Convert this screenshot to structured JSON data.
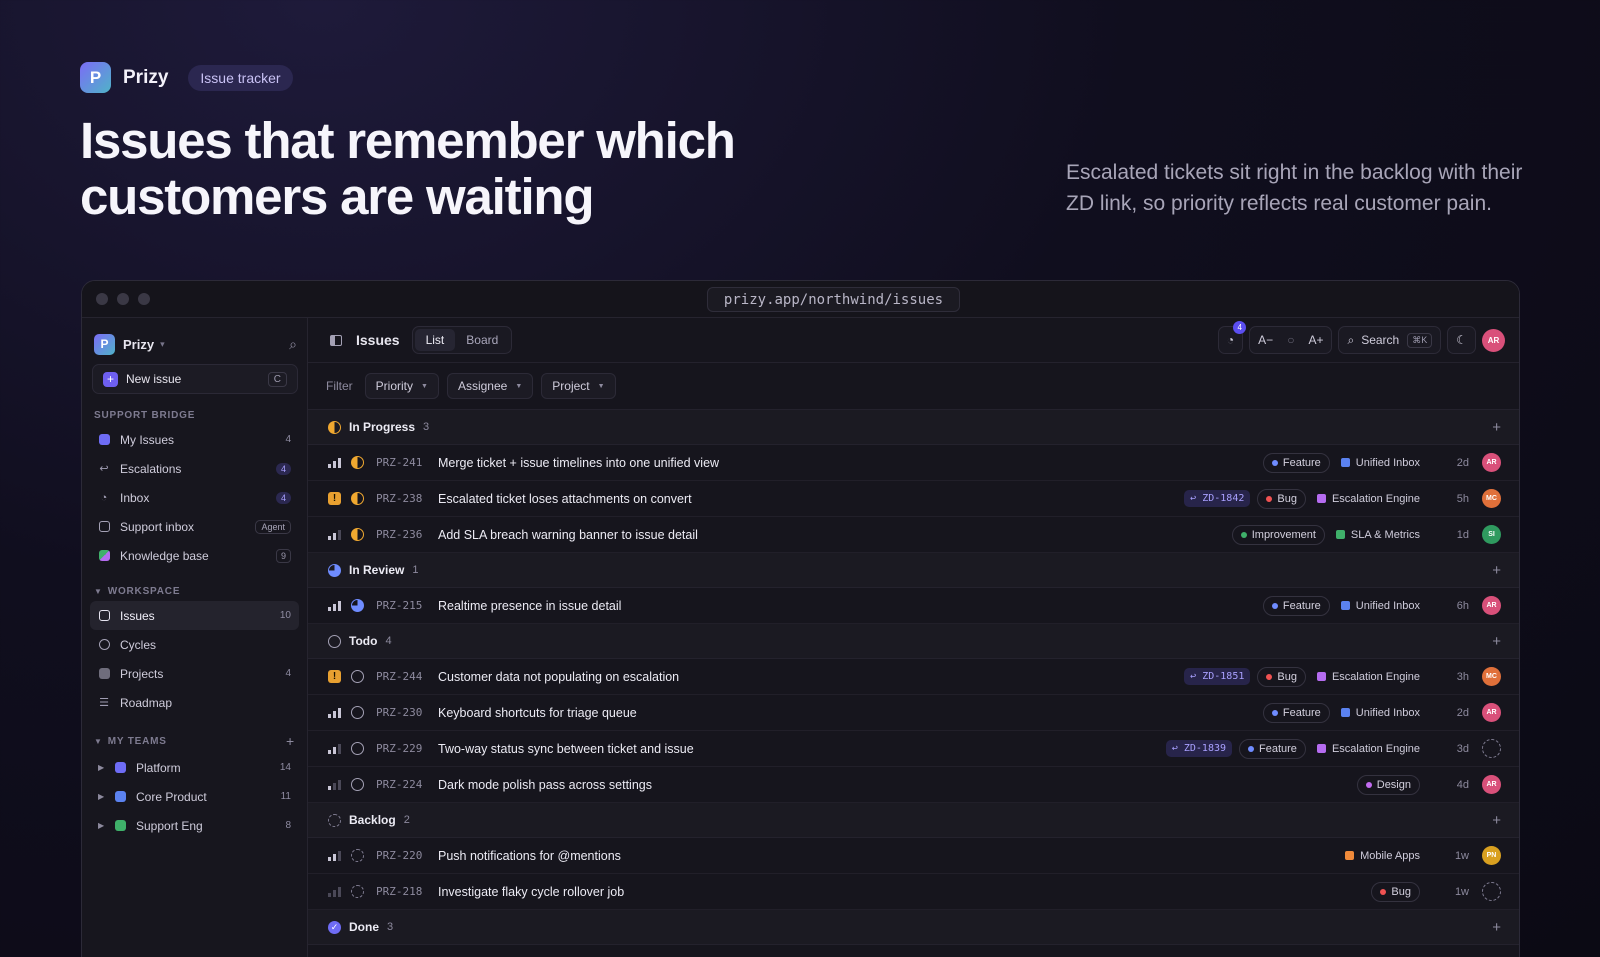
{
  "brand": {
    "name": "Prizy",
    "tag": "Issue tracker",
    "logo_letter": "P"
  },
  "hero": {
    "title": "Issues that remember which customers are waiting",
    "subtitle": "Escalated tickets sit right in the backlog with their ZD link, so priority reflects real customer pain."
  },
  "browser": {
    "url": "prizy.app/northwind/issues"
  },
  "sidebar": {
    "workspace_name": "Prizy",
    "new_issue": {
      "label": "New issue",
      "shortcut": "C"
    },
    "support_section": "SUPPORT BRIDGE",
    "support_items": [
      {
        "label": "My Issues",
        "count": "4"
      },
      {
        "label": "Escalations",
        "count": "4"
      },
      {
        "label": "Inbox",
        "count": "4"
      },
      {
        "label": "Support inbox",
        "badge": "Agent"
      },
      {
        "label": "Knowledge base",
        "count": "9"
      }
    ],
    "workspace_section": "WORKSPACE",
    "workspace_items": [
      {
        "label": "Issues",
        "count": "10"
      },
      {
        "label": "Cycles",
        "count": ""
      },
      {
        "label": "Projects",
        "count": "4"
      },
      {
        "label": "Roadmap",
        "count": ""
      }
    ],
    "teams_section": "MY TEAMS",
    "teams": [
      {
        "label": "Platform",
        "count": "14",
        "color": "#6e6cf5"
      },
      {
        "label": "Core Product",
        "count": "11",
        "color": "#5b82f0"
      },
      {
        "label": "Support Eng",
        "count": "8",
        "color": "#3fb06a"
      }
    ]
  },
  "topbar": {
    "title": "Issues",
    "views": [
      "List",
      "Board"
    ],
    "notif_count": "4",
    "zoom_out": "A−",
    "zoom_in": "A+",
    "search_label": "Search",
    "search_kbd": "⌘K",
    "user_initials": "AR"
  },
  "filters": {
    "label": "Filter",
    "items": [
      "Priority",
      "Assignee",
      "Project"
    ]
  },
  "groups": [
    {
      "label": "In Progress",
      "count": "3",
      "status": "progress",
      "rows": [
        {
          "id": "PRZ-241",
          "title": "Merge ticket + issue timelines into one unified view",
          "priority": 3,
          "zd": "",
          "tags": [
            {
              "label": "Feature",
              "color": "#6f8cff"
            }
          ],
          "project": {
            "label": "Unified Inbox",
            "color": "#5b82f0"
          },
          "age": "2d",
          "assignee": "AR",
          "assignee_color": "#d9507a"
        },
        {
          "id": "PRZ-238",
          "title": "Escalated ticket loses attachments on convert",
          "priority": "urgent",
          "zd": "↩ ZD-1842",
          "tags": [
            {
              "label": "Bug",
              "color": "#f05252"
            }
          ],
          "project": {
            "label": "Escalation Engine",
            "color": "#b56cf0"
          },
          "age": "5h",
          "assignee": "MC",
          "assignee_color": "#e0703a"
        },
        {
          "id": "PRZ-236",
          "title": "Add SLA breach warning banner to issue detail",
          "priority": 2,
          "zd": "",
          "tags": [
            {
              "label": "Improvement",
              "color": "#3fb06a"
            }
          ],
          "project": {
            "label": "SLA & Metrics",
            "color": "#3fb06a"
          },
          "age": "1d",
          "assignee": "SI",
          "assignee_color": "#2f9a5f"
        }
      ]
    },
    {
      "label": "In Review",
      "count": "1",
      "status": "review",
      "rows": [
        {
          "id": "PRZ-215",
          "title": "Realtime presence in issue detail",
          "priority": 3,
          "zd": "",
          "tags": [
            {
              "label": "Feature",
              "color": "#6f8cff"
            }
          ],
          "project": {
            "label": "Unified Inbox",
            "color": "#5b82f0"
          },
          "age": "6h",
          "assignee": "AR",
          "assignee_color": "#d9507a"
        }
      ]
    },
    {
      "label": "Todo",
      "count": "4",
      "status": "todo",
      "rows": [
        {
          "id": "PRZ-244",
          "title": "Customer data not populating on escalation",
          "priority": "urgent",
          "zd": "↩ ZD-1851",
          "tags": [
            {
              "label": "Bug",
              "color": "#f05252"
            }
          ],
          "project": {
            "label": "Escalation Engine",
            "color": "#b56cf0"
          },
          "age": "3h",
          "assignee": "MC",
          "assignee_color": "#e0703a"
        },
        {
          "id": "PRZ-230",
          "title": "Keyboard shortcuts for triage queue",
          "priority": 3,
          "zd": "",
          "tags": [
            {
              "label": "Feature",
              "color": "#6f8cff"
            }
          ],
          "project": {
            "label": "Unified Inbox",
            "color": "#5b82f0"
          },
          "age": "2d",
          "assignee": "AR",
          "assignee_color": "#d9507a"
        },
        {
          "id": "PRZ-229",
          "title": "Two-way status sync between ticket and issue",
          "priority": 2,
          "zd": "↩ ZD-1839",
          "tags": [
            {
              "label": "Feature",
              "color": "#6f8cff"
            }
          ],
          "project": {
            "label": "Escalation Engine",
            "color": "#b56cf0"
          },
          "age": "3d",
          "assignee": "",
          "assignee_color": ""
        },
        {
          "id": "PRZ-224",
          "title": "Dark mode polish pass across settings",
          "priority": 1,
          "zd": "",
          "tags": [
            {
              "label": "Design",
              "color": "#c26cf0"
            }
          ],
          "project": null,
          "age": "4d",
          "assignee": "AR",
          "assignee_color": "#d9507a"
        }
      ]
    },
    {
      "label": "Backlog",
      "count": "2",
      "status": "backlog",
      "rows": [
        {
          "id": "PRZ-220",
          "title": "Push notifications for @mentions",
          "priority": 2,
          "zd": "",
          "tags": [],
          "project": {
            "label": "Mobile Apps",
            "color": "#f08a3a"
          },
          "age": "1w",
          "assignee": "PN",
          "assignee_color": "#d9a020"
        },
        {
          "id": "PRZ-218",
          "title": "Investigate flaky cycle rollover job",
          "priority": 0,
          "zd": "",
          "tags": [
            {
              "label": "Bug",
              "color": "#f05252"
            }
          ],
          "project": null,
          "age": "1w",
          "assignee": "",
          "assignee_color": ""
        }
      ]
    },
    {
      "label": "Done",
      "count": "3",
      "status": "done",
      "rows": []
    }
  ]
}
